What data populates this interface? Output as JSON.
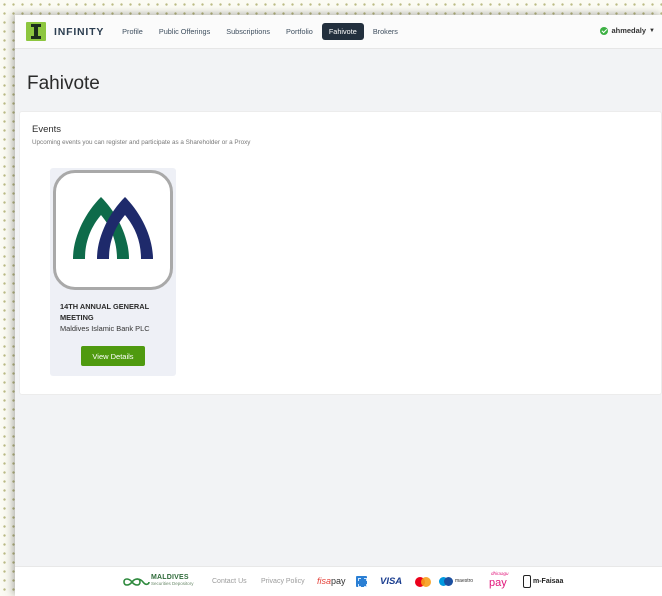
{
  "navbar": {
    "brand": "INFINITY",
    "items": [
      {
        "label": "Profile"
      },
      {
        "label": "Public Offerings"
      },
      {
        "label": "Subscriptions"
      },
      {
        "label": "Portfolio"
      },
      {
        "label": "Fahivote",
        "active": true
      },
      {
        "label": "Brokers"
      }
    ],
    "user": "ahmedaly"
  },
  "page": {
    "title": "Fahivote"
  },
  "events": {
    "heading": "Events",
    "subtitle": "Upcoming events you can register and participate as a Shareholder or a Proxy",
    "cards": [
      {
        "title": "14TH ANNUAL GENERAL MEETING",
        "company": "Maldives Islamic Bank PLC",
        "button": "View Details",
        "logo_colors": {
          "green": "#0e6b4a",
          "navy": "#1e2a6b"
        }
      }
    ]
  },
  "footer": {
    "mcsd_title": "MALDIVES",
    "mcsd_sub": "Securities Depository",
    "contact": "Contact Us",
    "privacy": "Privacy Policy",
    "fisa_a": "fisa",
    "fisa_b": "pay",
    "visa": "VISA",
    "maestro": "maestro",
    "pay_small": "dhiraagu",
    "pay": "pay",
    "mfaisaa": "m-Faisaa"
  },
  "colors": {
    "accent_green": "#4f9a0f",
    "nav_active": "#23303e",
    "brand_green": "#8dc63f"
  }
}
